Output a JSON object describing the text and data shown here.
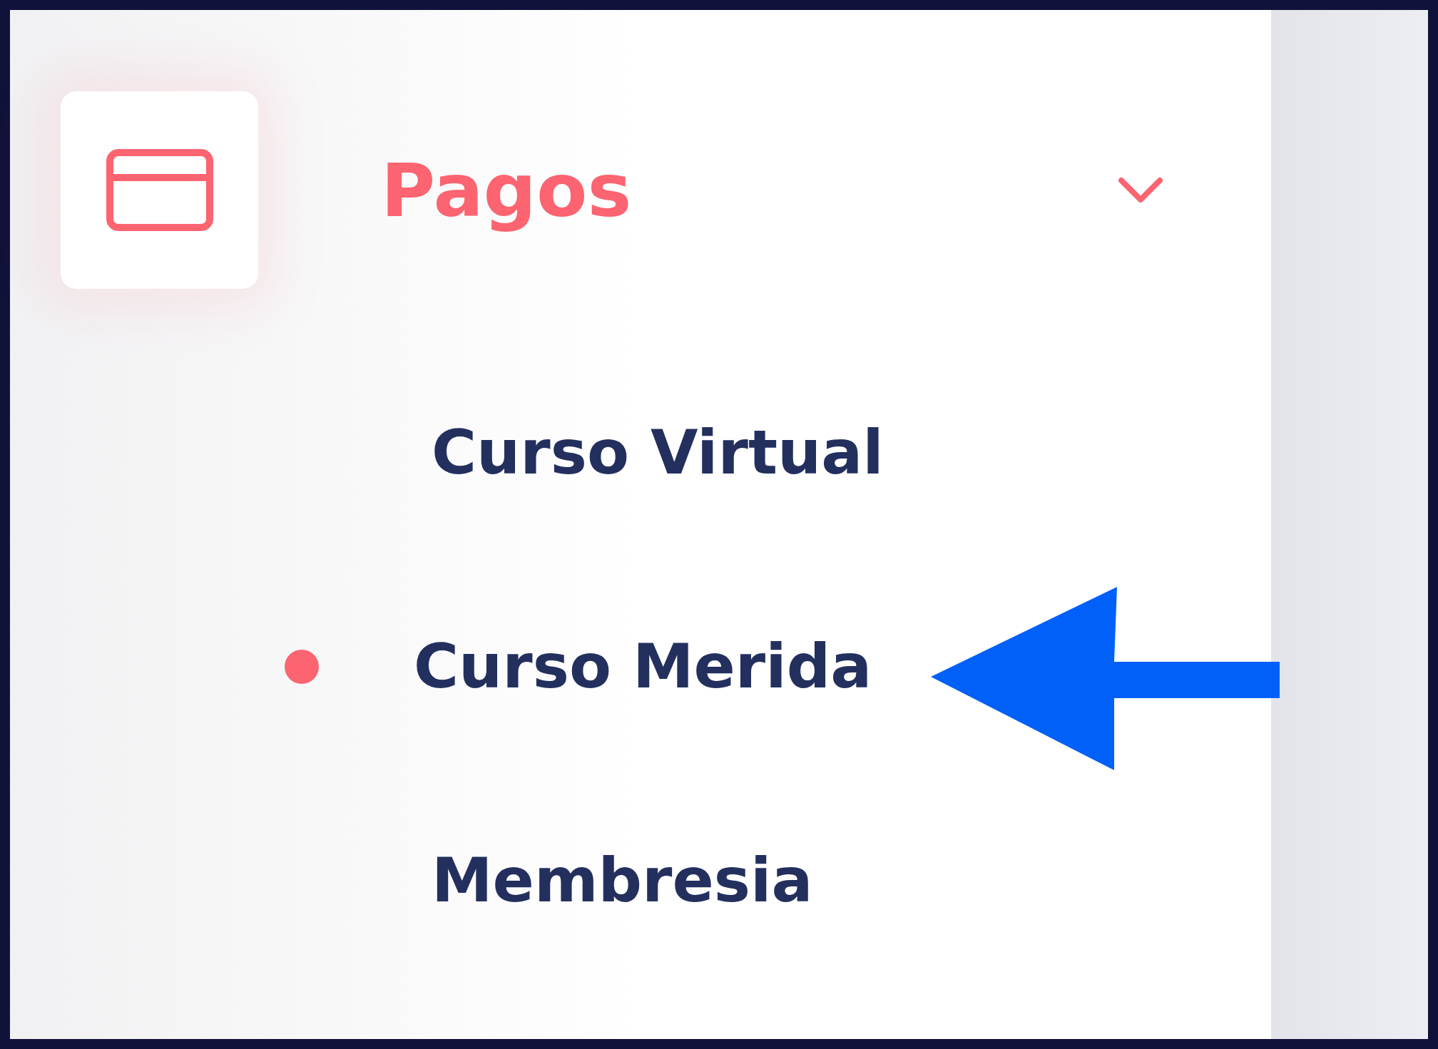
{
  "menu": {
    "label": "Pagos",
    "active": true,
    "expanded": true,
    "children": [
      {
        "label": "Curso Virtual",
        "selected": false
      },
      {
        "label": "Curso Merida",
        "selected": true
      },
      {
        "label": "Membresia",
        "selected": false
      }
    ]
  }
}
